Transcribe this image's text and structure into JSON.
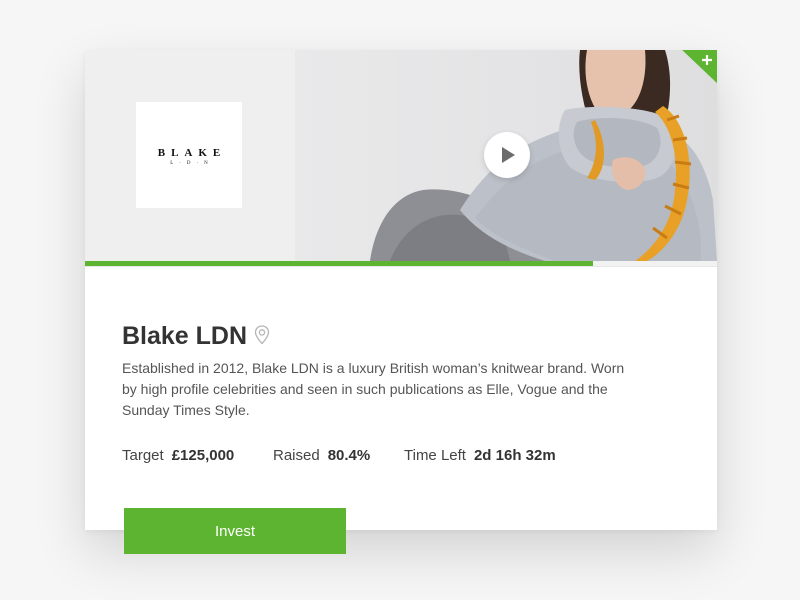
{
  "brand": {
    "logo_word": "BLAKE",
    "logo_sub": "L·D·N",
    "name": "Blake LDN",
    "description": "Established in 2012, Blake LDN is a luxury British woman’s knitwear brand. Worn by high profile celebrities and seen in such publications as Elle, Vogue and the Sunday Times Style."
  },
  "progress": {
    "raised_fraction": 0.804
  },
  "stats": {
    "target_label": "Target",
    "target_value": "£125,000",
    "raised_label": "Raised",
    "raised_value": "80.4%",
    "time_label": "Time Left",
    "time_value": "2d 16h 32m"
  },
  "actions": {
    "invest_label": "Invest"
  },
  "icons": {
    "play": "play-icon",
    "location": "location-pin-icon",
    "corner": "plus-icon"
  },
  "colors": {
    "accent": "#5db431",
    "text": "#333333",
    "muted_text": "#555555"
  }
}
